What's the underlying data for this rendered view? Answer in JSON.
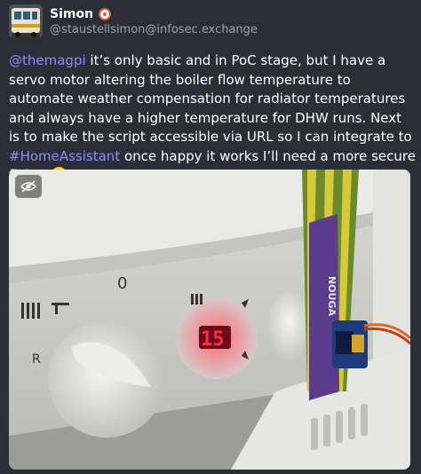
{
  "post": {
    "display_name": "Simon",
    "handle": "@staustellsimon@infosec.exchange",
    "content": {
      "mention": "@themagpi",
      "text_1": " it’s only basic and in PoC stage, but I have a servo motor altering the boiler flow temperature to automate weather compensation for radiator temperatures and always have a higher temperature for DHW runs. Next is to make the script accessible via URL so I can integrate to ",
      "hashtag": "#HomeAssistant",
      "text_2": " once happy it works I’ll need a more secure fixing "
    },
    "image": {
      "display_value": "15",
      "knob_label_zero": "0",
      "knob_label_r": "R",
      "tape_text": "NOUGA"
    }
  },
  "colors": {
    "background": "#2b2e36",
    "link": "#8c8dff",
    "handle": "#9aa2b1",
    "bot_badge": "#d8603b"
  },
  "icons": {
    "hide_media": "eye-slash-icon",
    "bot": "bot-badge-icon",
    "emoji": "smiling-face-emoji"
  }
}
